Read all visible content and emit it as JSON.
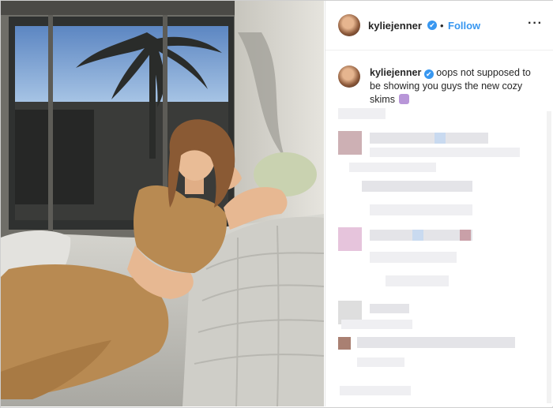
{
  "post": {
    "username": "kyliejenner",
    "follow_label": "Follow",
    "separator": "•",
    "more_label": "···",
    "verified_mark": "✔",
    "caption": "oops not supposed to be showing you guys the new cozy skims",
    "caption_emoji": "person-tipping-hand-emoji"
  },
  "icons": {
    "verified": "verified-badge-icon",
    "more": "more-options-icon"
  },
  "colors": {
    "accent": "#3897f0",
    "text": "#262626",
    "outfit": "#b88a52"
  }
}
